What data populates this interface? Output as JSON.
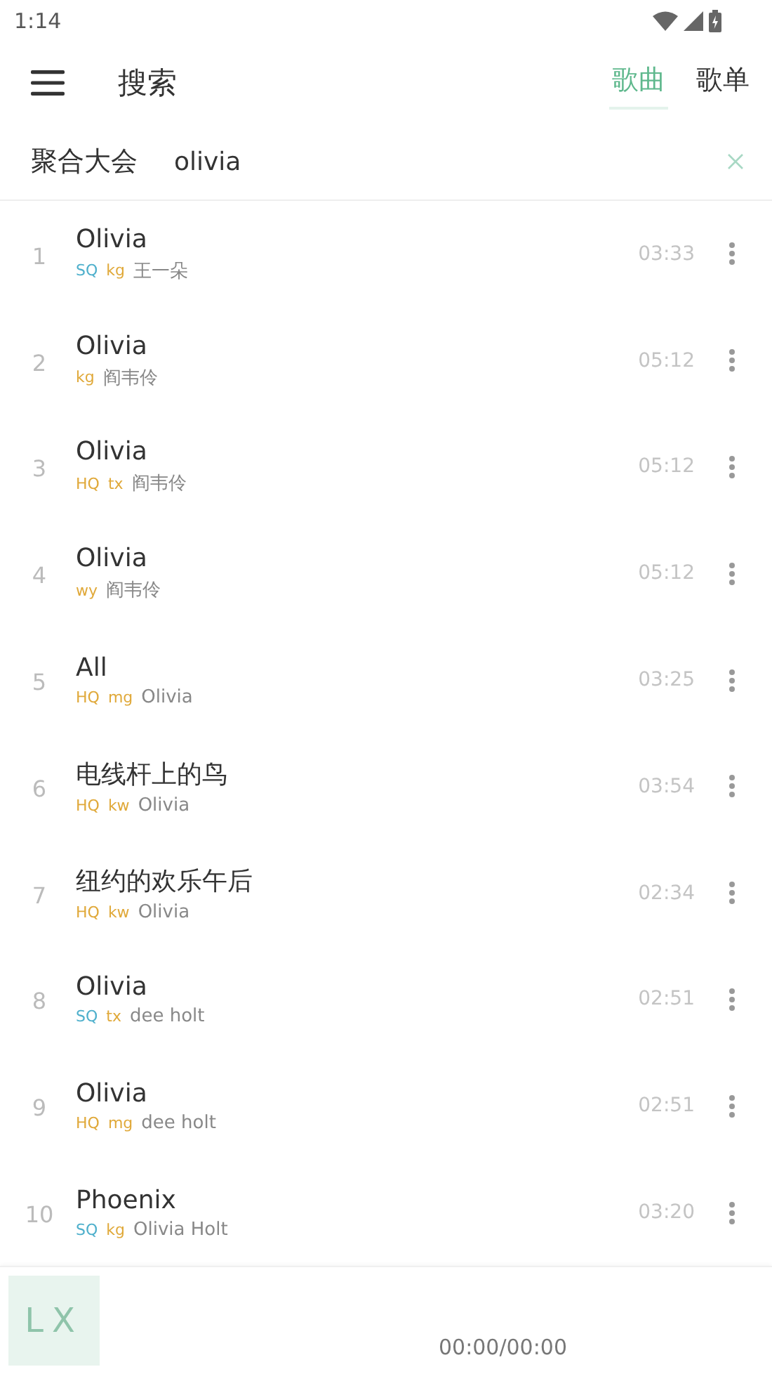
{
  "status_bar": {
    "time": "1:14"
  },
  "header": {
    "title": "搜索",
    "tabs": [
      {
        "label": "歌曲",
        "selected": true
      },
      {
        "label": "歌单",
        "selected": false
      }
    ]
  },
  "search": {
    "source": "聚合大会",
    "value": "olivia"
  },
  "songs": [
    {
      "index": "1",
      "title": "Olivia",
      "tags": [
        {
          "text": "SQ",
          "color": "#4fb0cc"
        },
        {
          "text": "kg",
          "color": "#e0a93a"
        }
      ],
      "artist": "王一朵",
      "duration": "03:33"
    },
    {
      "index": "2",
      "title": "Olivia",
      "tags": [
        {
          "text": "kg",
          "color": "#e0a93a"
        }
      ],
      "artist": "阎韦伶",
      "duration": "05:12"
    },
    {
      "index": "3",
      "title": "Olivia",
      "tags": [
        {
          "text": "HQ",
          "color": "#e0a93a"
        },
        {
          "text": "tx",
          "color": "#e0a93a"
        }
      ],
      "artist": "阎韦伶",
      "duration": "05:12"
    },
    {
      "index": "4",
      "title": "Olivia",
      "tags": [
        {
          "text": "wy",
          "color": "#e0a93a"
        }
      ],
      "artist": "阎韦伶",
      "duration": "05:12"
    },
    {
      "index": "5",
      "title": "All",
      "tags": [
        {
          "text": "HQ",
          "color": "#e0a93a"
        },
        {
          "text": "mg",
          "color": "#e0a93a"
        }
      ],
      "artist": "Olivia",
      "duration": "03:25"
    },
    {
      "index": "6",
      "title": "电线杆上的鸟",
      "tags": [
        {
          "text": "HQ",
          "color": "#e0a93a"
        },
        {
          "text": "kw",
          "color": "#e0a93a"
        }
      ],
      "artist": "Olivia",
      "duration": "03:54"
    },
    {
      "index": "7",
      "title": "纽约的欢乐午后",
      "tags": [
        {
          "text": "HQ",
          "color": "#e0a93a"
        },
        {
          "text": "kw",
          "color": "#e0a93a"
        }
      ],
      "artist": "Olivia",
      "duration": "02:34"
    },
    {
      "index": "8",
      "title": "Olivia",
      "tags": [
        {
          "text": "SQ",
          "color": "#4fb0cc"
        },
        {
          "text": "tx",
          "color": "#e0a93a"
        }
      ],
      "artist": "dee holt",
      "duration": "02:51"
    },
    {
      "index": "9",
      "title": "Olivia",
      "tags": [
        {
          "text": "HQ",
          "color": "#e0a93a"
        },
        {
          "text": "mg",
          "color": "#e0a93a"
        }
      ],
      "artist": "dee holt",
      "duration": "02:51"
    },
    {
      "index": "10",
      "title": "Phoenix",
      "tags": [
        {
          "text": "SQ",
          "color": "#4fb0cc"
        },
        {
          "text": "kg",
          "color": "#e0a93a"
        }
      ],
      "artist": "Olivia Holt",
      "duration": "03:20"
    }
  ],
  "player": {
    "logo": "LX",
    "time": "00:00/00:00"
  }
}
